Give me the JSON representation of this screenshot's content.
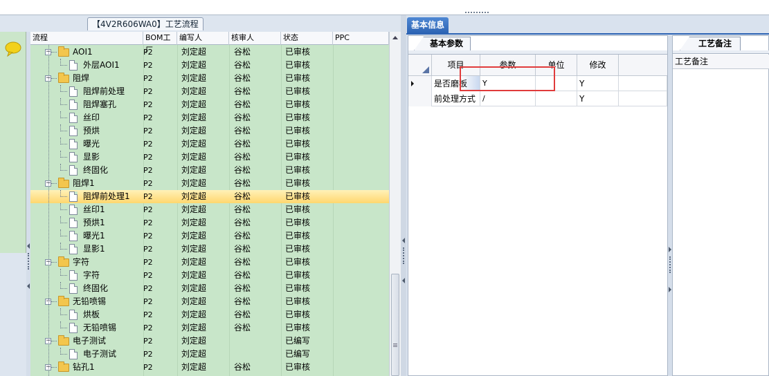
{
  "left_panel": {
    "title": "【4V2R606WA0】工艺流程",
    "columns": [
      "流程",
      "BOM工厂",
      "编写人",
      "核审人",
      "状态",
      "PPC"
    ],
    "rows": [
      {
        "level": 1,
        "type": "folder",
        "name": "AOI1",
        "plant": "P2",
        "author": "刘定超",
        "reviewer": "谷松",
        "status": "已审核"
      },
      {
        "level": 2,
        "type": "doc",
        "name": "外层AOI1",
        "plant": "P2",
        "author": "刘定超",
        "reviewer": "谷松",
        "status": "已审核"
      },
      {
        "level": 1,
        "type": "folder",
        "name": "阻焊",
        "plant": "P2",
        "author": "刘定超",
        "reviewer": "谷松",
        "status": "已审核"
      },
      {
        "level": 2,
        "type": "doc",
        "name": "阻焊前处理",
        "plant": "P2",
        "author": "刘定超",
        "reviewer": "谷松",
        "status": "已审核"
      },
      {
        "level": 2,
        "type": "doc",
        "name": "阻焊塞孔",
        "plant": "P2",
        "author": "刘定超",
        "reviewer": "谷松",
        "status": "已审核"
      },
      {
        "level": 2,
        "type": "doc",
        "name": "丝印",
        "plant": "P2",
        "author": "刘定超",
        "reviewer": "谷松",
        "status": "已审核"
      },
      {
        "level": 2,
        "type": "doc",
        "name": "预烘",
        "plant": "P2",
        "author": "刘定超",
        "reviewer": "谷松",
        "status": "已审核"
      },
      {
        "level": 2,
        "type": "doc",
        "name": "曝光",
        "plant": "P2",
        "author": "刘定超",
        "reviewer": "谷松",
        "status": "已审核"
      },
      {
        "level": 2,
        "type": "doc",
        "name": "显影",
        "plant": "P2",
        "author": "刘定超",
        "reviewer": "谷松",
        "status": "已审核"
      },
      {
        "level": 2,
        "type": "doc",
        "name": "终固化",
        "plant": "P2",
        "author": "刘定超",
        "reviewer": "谷松",
        "status": "已审核"
      },
      {
        "level": 1,
        "type": "folder",
        "name": "阻焊1",
        "plant": "P2",
        "author": "刘定超",
        "reviewer": "谷松",
        "status": "已审核"
      },
      {
        "level": 2,
        "type": "doc",
        "name": "阻焊前处理1",
        "plant": "P2",
        "author": "刘定超",
        "reviewer": "谷松",
        "status": "已审核",
        "selected": true
      },
      {
        "level": 2,
        "type": "doc",
        "name": "丝印1",
        "plant": "P2",
        "author": "刘定超",
        "reviewer": "谷松",
        "status": "已审核"
      },
      {
        "level": 2,
        "type": "doc",
        "name": "预烘1",
        "plant": "P2",
        "author": "刘定超",
        "reviewer": "谷松",
        "status": "已审核"
      },
      {
        "level": 2,
        "type": "doc",
        "name": "曝光1",
        "plant": "P2",
        "author": "刘定超",
        "reviewer": "谷松",
        "status": "已审核"
      },
      {
        "level": 2,
        "type": "doc",
        "name": "显影1",
        "plant": "P2",
        "author": "刘定超",
        "reviewer": "谷松",
        "status": "已审核"
      },
      {
        "level": 1,
        "type": "folder",
        "name": "字符",
        "plant": "P2",
        "author": "刘定超",
        "reviewer": "谷松",
        "status": "已审核"
      },
      {
        "level": 2,
        "type": "doc",
        "name": "字符",
        "plant": "P2",
        "author": "刘定超",
        "reviewer": "谷松",
        "status": "已审核"
      },
      {
        "level": 2,
        "type": "doc",
        "name": "终固化",
        "plant": "P2",
        "author": "刘定超",
        "reviewer": "谷松",
        "status": "已审核"
      },
      {
        "level": 1,
        "type": "folder",
        "name": "无铅喷锡",
        "plant": "P2",
        "author": "刘定超",
        "reviewer": "谷松",
        "status": "已审核"
      },
      {
        "level": 2,
        "type": "doc",
        "name": "烘板",
        "plant": "P2",
        "author": "刘定超",
        "reviewer": "谷松",
        "status": "已审核"
      },
      {
        "level": 2,
        "type": "doc",
        "name": "无铅喷锡",
        "plant": "P2",
        "author": "刘定超",
        "reviewer": "谷松",
        "status": "已审核"
      },
      {
        "level": 1,
        "type": "folder",
        "name": "电子测试",
        "plant": "P2",
        "author": "刘定超",
        "reviewer": "",
        "status": "已编写"
      },
      {
        "level": 2,
        "type": "doc",
        "name": "电子测试",
        "plant": "P2",
        "author": "刘定超",
        "reviewer": "",
        "status": "已编写"
      },
      {
        "level": 1,
        "type": "folder",
        "name": "钻孔1",
        "plant": "P2",
        "author": "刘定超",
        "reviewer": "谷松",
        "status": "已审核"
      }
    ]
  },
  "right_panel": {
    "tab": "基本信息",
    "params": {
      "tab": "基本参数",
      "columns": [
        "项目",
        "参数",
        "单位",
        "修改"
      ],
      "rows": [
        {
          "item": "是否磨板",
          "value": "Y",
          "unit": "",
          "modify": "Y",
          "current": true
        },
        {
          "item": "前处理方式",
          "value": "/",
          "unit": "",
          "modify": "Y"
        }
      ]
    },
    "notes": {
      "tab": "工艺备注",
      "header": "工艺备注"
    }
  },
  "icons": {
    "icon_panel": "chat-bubble-icon",
    "folder": "folder-icon",
    "doc": "document-icon"
  },
  "colors": {
    "grid_bg": "#c8e6c9",
    "selected_row": "#ffd76e",
    "tab_active": "#2d64b4",
    "focus_box": "#e03b3b"
  }
}
